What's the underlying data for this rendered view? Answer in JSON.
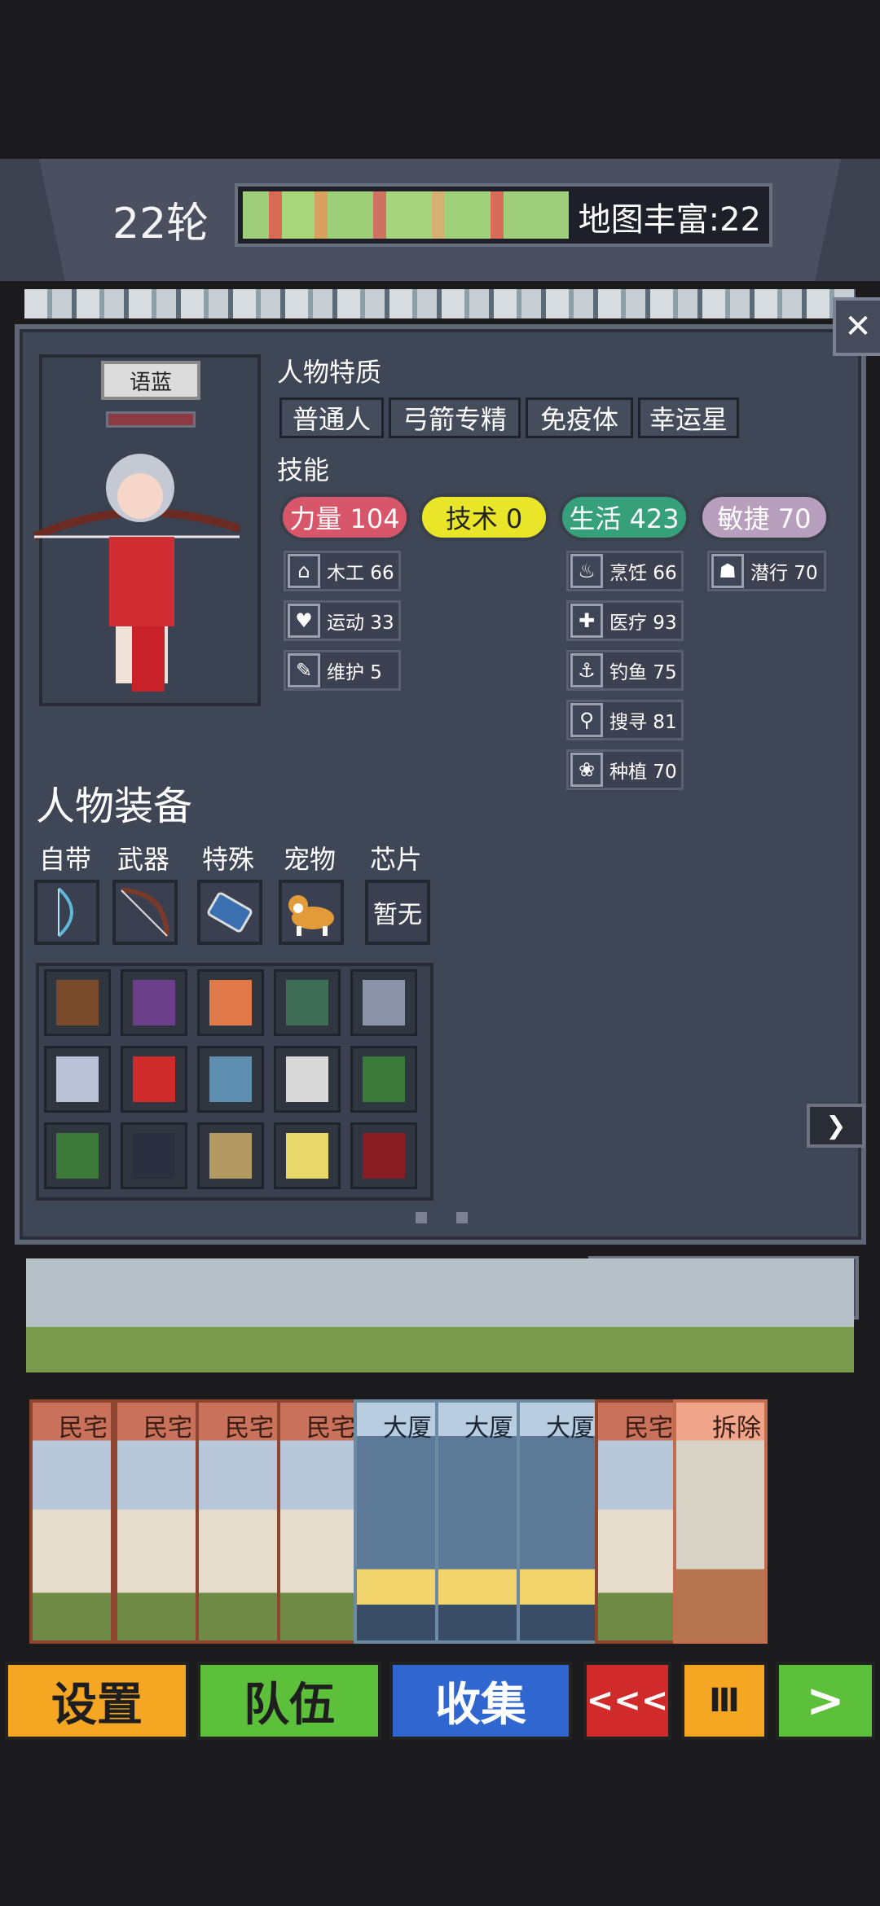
{
  "hud": {
    "round": "22轮",
    "map_label": "地图丰富:22"
  },
  "panel": {
    "name": "语蓝",
    "traits_title": "人物特质",
    "traits": [
      "普通人",
      "弓箭专精",
      "免疫体",
      "幸运星"
    ],
    "skills_title": "技能",
    "stats": [
      {
        "label": "力量 104",
        "color": "#d8566a"
      },
      {
        "label": "技术 0",
        "color": "#e9e62a"
      },
      {
        "label": "生活 423",
        "color": "#36a07a"
      },
      {
        "label": "敏捷 70",
        "color": "#b79fbd"
      }
    ],
    "skills_col1": [
      {
        "icon": "house-icon",
        "label": "木工 66"
      },
      {
        "icon": "heart-icon",
        "label": "运动 33"
      },
      {
        "icon": "wrench-icon",
        "label": "维护 5"
      }
    ],
    "skills_col3": [
      {
        "icon": "pot-icon",
        "label": "烹饪 66"
      },
      {
        "icon": "medkit-icon",
        "label": "医疗 93"
      },
      {
        "icon": "fishing-icon",
        "label": "钓鱼 75"
      },
      {
        "icon": "magnifier-icon",
        "label": "搜寻 81"
      },
      {
        "icon": "plant-icon",
        "label": "种植 70"
      }
    ],
    "skills_col4": [
      {
        "icon": "sneak-icon",
        "label": "潜行 70"
      }
    ],
    "equip_title": "人物装备",
    "slots": [
      {
        "label": "自带",
        "icon": "bow-icon",
        "text": ""
      },
      {
        "label": "武器",
        "icon": "longbow-icon",
        "text": ""
      },
      {
        "label": "特殊",
        "icon": "battery-icon",
        "text": ""
      },
      {
        "label": "宠物",
        "icon": "corgi-icon",
        "text": ""
      },
      {
        "label": "芯片",
        "icon": "",
        "text": "暂无"
      }
    ],
    "inventory": [
      "backpack-icon",
      "vest-icon",
      "ring-icon",
      "jacket-icon",
      "armor-icon",
      "coat-icon",
      "firstaid-icon",
      "boots-icon",
      "sneaker-icon",
      "card-heart-icon",
      "card-heart-icon",
      "book-icon",
      "boot-icon",
      "manual-icon",
      "muscle-book-icon"
    ],
    "close_label": "关 闭"
  },
  "cards": [
    {
      "title": "民宅",
      "type": "house"
    },
    {
      "title": "民宅",
      "type": "house"
    },
    {
      "title": "民宅",
      "type": "house"
    },
    {
      "title": "民宅",
      "type": "house"
    },
    {
      "title": "大厦",
      "type": "tower"
    },
    {
      "title": "大厦",
      "type": "tower"
    },
    {
      "title": "大厦",
      "type": "tower"
    },
    {
      "title": "民宅",
      "type": "house"
    },
    {
      "title": "拆除",
      "type": "demo"
    }
  ],
  "buttons": [
    {
      "label": "设置",
      "color": "#f5a623"
    },
    {
      "label": "队伍",
      "color": "#5cc03a"
    },
    {
      "label": "收集",
      "color": "#2f66d0"
    },
    {
      "label": "<<<",
      "color": "#d02a2a"
    },
    {
      "label": "Ⅲ",
      "color": "#f5a623"
    },
    {
      "label": ">",
      "color": "#5cc03a"
    }
  ],
  "colors": {
    "panel_bg": "#3f4656",
    "accent_green": "#5cc03a"
  }
}
